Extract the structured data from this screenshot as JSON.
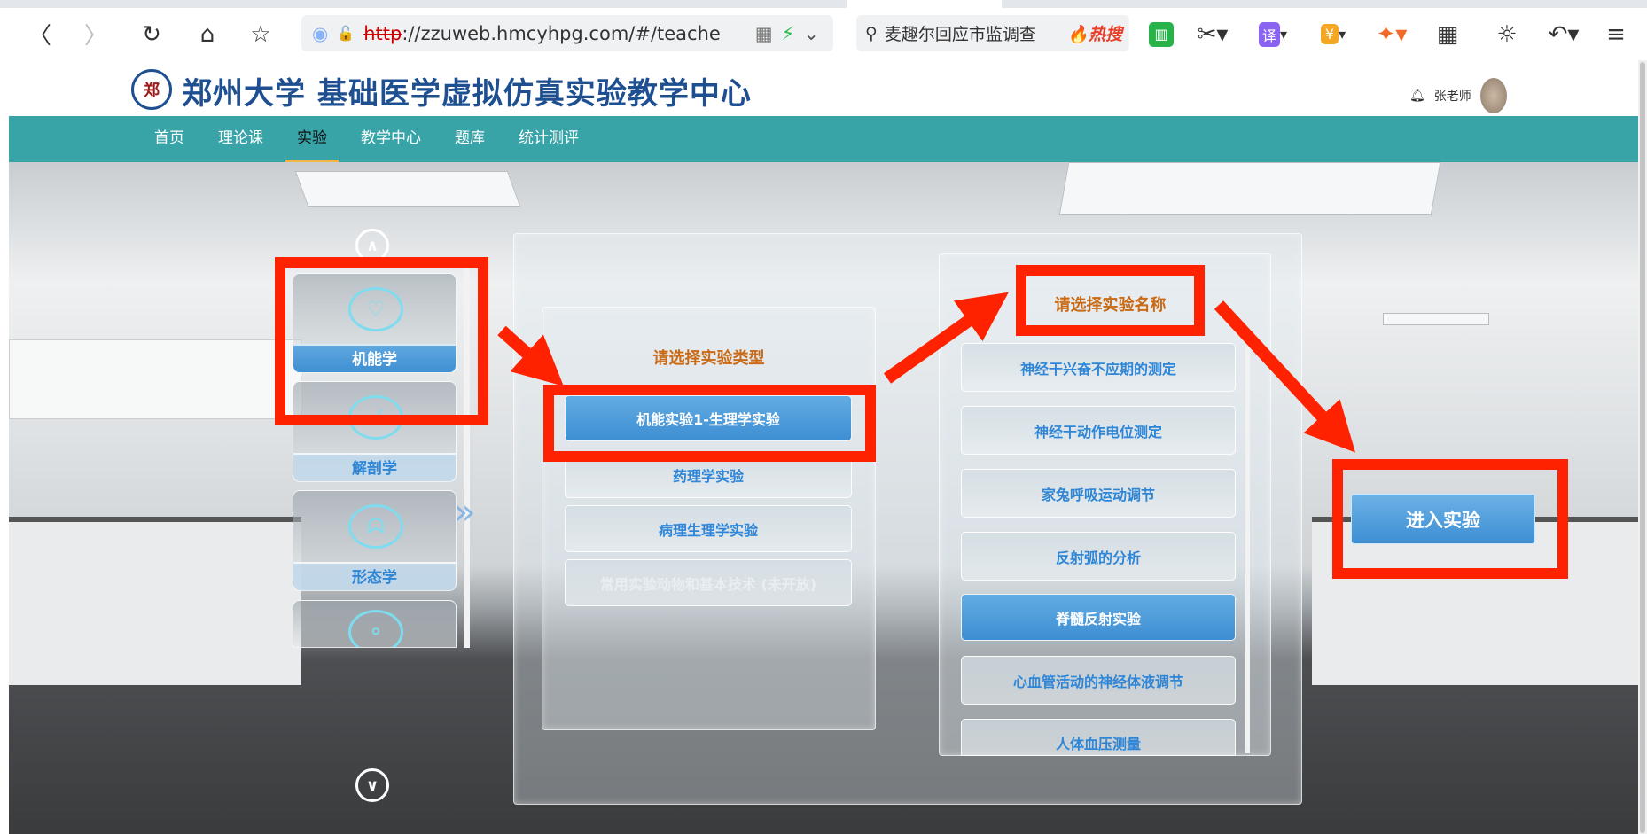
{
  "browser": {
    "url_prefix": "http",
    "url_rest": "://zzuweb.hmcyhpg.com/#/teache",
    "search_text": "麦趣尔回应市监调查",
    "search_hot": "🔥热搜",
    "icons": [
      "back-icon",
      "forward-icon",
      "reload-icon",
      "home-icon",
      "star-icon",
      "qr-icon",
      "lightning-icon",
      "chevron-down-icon",
      "search-icon",
      "book-icon",
      "scissors-icon",
      "translate-icon",
      "coupon-icon",
      "game-icon",
      "grid-icon",
      "brightness-icon",
      "undo-icon",
      "menu-icon"
    ],
    "translate_label": "译",
    "coupon_label": "¥"
  },
  "header": {
    "seal_text": "郑",
    "site_title": "郑州大学 基础医学虚拟仿真实验教学中心",
    "user_name": "张老师"
  },
  "nav": {
    "items": [
      "首页",
      "理论课",
      "实验",
      "教学中心",
      "题库",
      "统计测评"
    ],
    "active": "实验"
  },
  "disciplines": [
    {
      "label": "机能学",
      "icon": "heart-pulse-icon",
      "glyph": "♡",
      "selected": true
    },
    {
      "label": "解剖学",
      "icon": "scalpel-icon",
      "glyph": "⟋",
      "selected": false
    },
    {
      "label": "形态学",
      "icon": "lungs-icon",
      "glyph": "ᗣ",
      "selected": false
    },
    {
      "label": "",
      "icon": "molecule-icon",
      "glyph": "⚬",
      "selected": false
    }
  ],
  "type_panel": {
    "title": "请选择实验类型",
    "options": [
      {
        "label": "机能实验1-生理学实验",
        "state": "selected"
      },
      {
        "label": "药理学实验",
        "state": "normal"
      },
      {
        "label": "病理生理学实验",
        "state": "normal"
      },
      {
        "label": "常用实验动物和基本技术 (未开放)",
        "state": "disabled"
      }
    ]
  },
  "name_panel": {
    "title": "请选择实验名称",
    "options": [
      {
        "label": "神经干兴奋不应期的测定",
        "state": "normal"
      },
      {
        "label": "神经干动作电位测定",
        "state": "normal"
      },
      {
        "label": "家兔呼吸运动调节",
        "state": "normal"
      },
      {
        "label": "反射弧的分析",
        "state": "normal"
      },
      {
        "label": "脊髓反射实验",
        "state": "selected"
      },
      {
        "label": "心血管活动的神经体液调节",
        "state": "normal"
      },
      {
        "label": "人体血压测量",
        "state": "normal"
      }
    ]
  },
  "enter_button": "进入实验",
  "colors": {
    "nav": "#38a4a8",
    "accent": "#3d8ed3",
    "annotation": "#ff2200",
    "title": "#c96a16"
  }
}
